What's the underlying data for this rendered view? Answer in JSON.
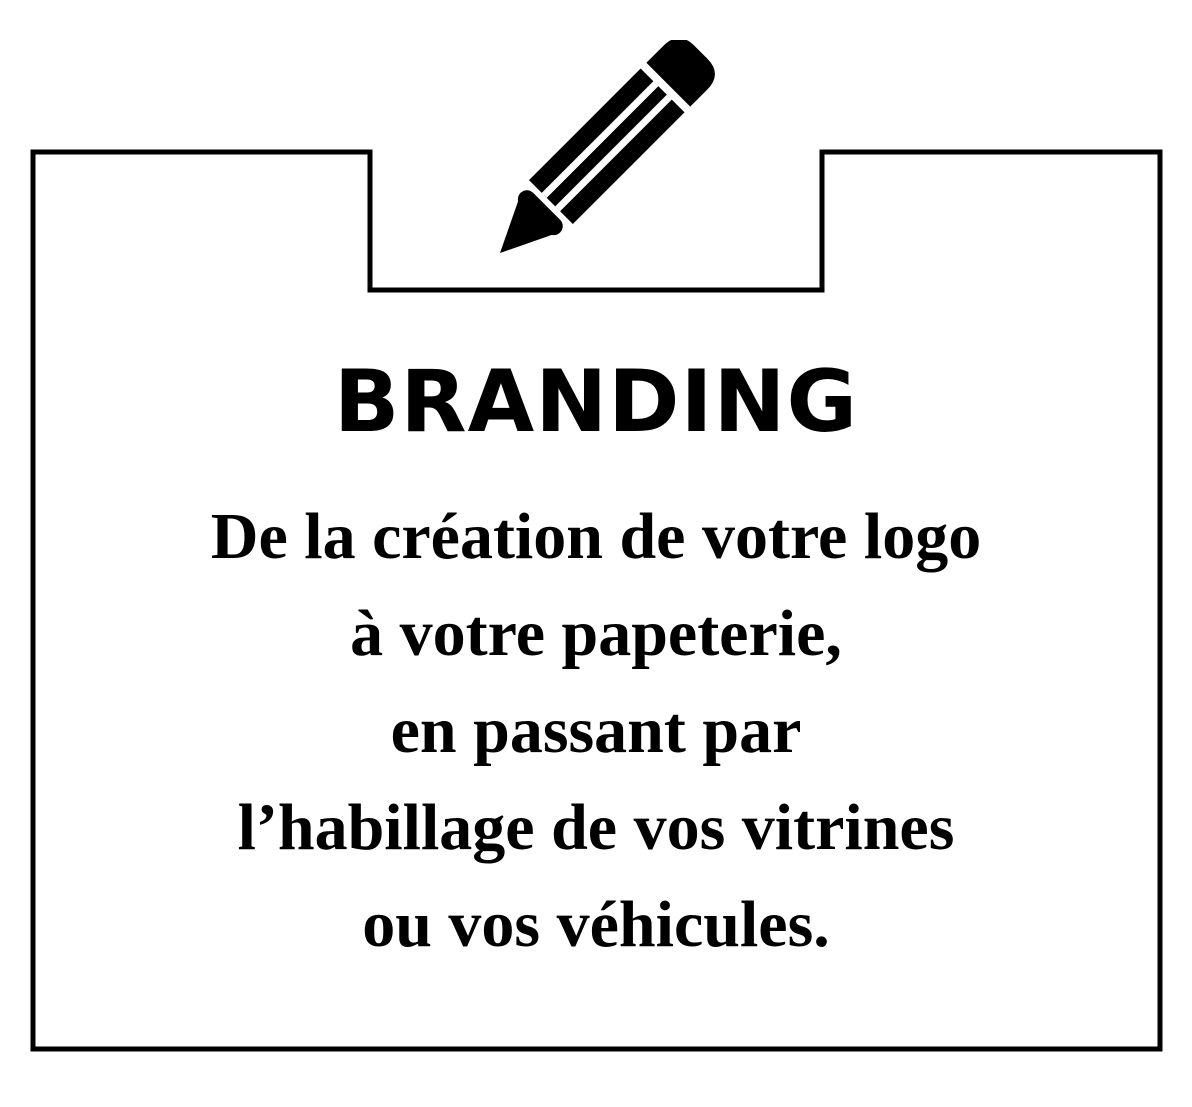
{
  "card": {
    "title": "BRANDING",
    "icon": "pencil-icon",
    "lines": [
      "De la création de votre logo",
      "à votre papeterie,",
      "en passant par",
      "l’habillage de vos vitrines",
      "ou vos véhicules."
    ]
  },
  "colors": {
    "ink": "#000000",
    "background": "#ffffff"
  }
}
